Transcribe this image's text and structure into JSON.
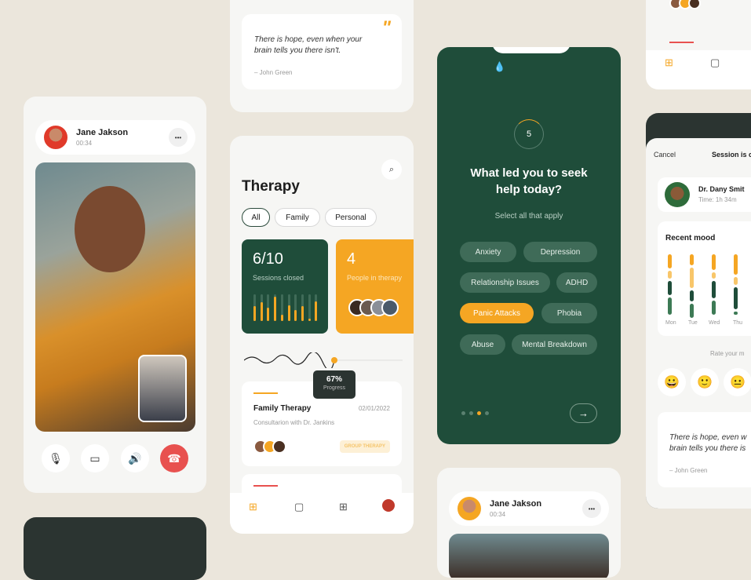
{
  "call": {
    "name": "Jane Jakson",
    "time": "00:34",
    "more": "•••"
  },
  "quote": {
    "text": "There is hope, even when your brain tells you there isn't.",
    "author": "–  John Green",
    "mark": "\""
  },
  "therapy": {
    "title": "Therapy",
    "tabs": [
      "All",
      "Family",
      "Personal"
    ],
    "selected_tab": "All",
    "sessions": {
      "value": "6/10",
      "label": "Sessions closed",
      "bars": [
        0.55,
        0.7,
        0.5,
        0.9,
        0.25,
        0.6,
        0.4,
        0.55,
        0.0,
        0.75
      ]
    },
    "people": {
      "value": "4",
      "label": "People in therapy"
    },
    "progress": {
      "value": "67%",
      "label": "Progress",
      "fraction": 0.67
    },
    "session_card": {
      "title": "Family Therapy",
      "date": "02/01/2022",
      "subtitle": "Consultarion with Dr. Jankins",
      "badge": "GROUP THERAPY"
    }
  },
  "question": {
    "step": "5",
    "title": "What led you to seek help today?",
    "subtitle": "Select all that apply",
    "options": [
      "Anxiety",
      "Depression",
      "Relationship Issues",
      "ADHD",
      "Panic Attacks",
      "Phobia",
      "Abuse",
      "Mental Breakdown"
    ],
    "selected": "Panic Attacks",
    "next": "→",
    "page_dots": 4,
    "current_page": 3
  },
  "session": {
    "cancel": "Cancel",
    "title": "Session is c",
    "doctor": "Dr. Dany Smit",
    "time": "Time: 1h 34m",
    "mood_title": "Recent mood",
    "days": [
      "Mon",
      "Tue",
      "Wed",
      "Thu"
    ],
    "rate": "Rate your m",
    "emojis": [
      "😀",
      "🙂",
      "😐"
    ],
    "quote": "There is hope, even w brain tells you there is",
    "author": "–  John Green"
  },
  "call2": {
    "name": "Jane Jakson",
    "time": "00:34",
    "more": "•••"
  },
  "colors": {
    "green": "#1f4d3a",
    "orange": "#f5a623",
    "red": "#e8514f",
    "dark": "#2b3431"
  }
}
